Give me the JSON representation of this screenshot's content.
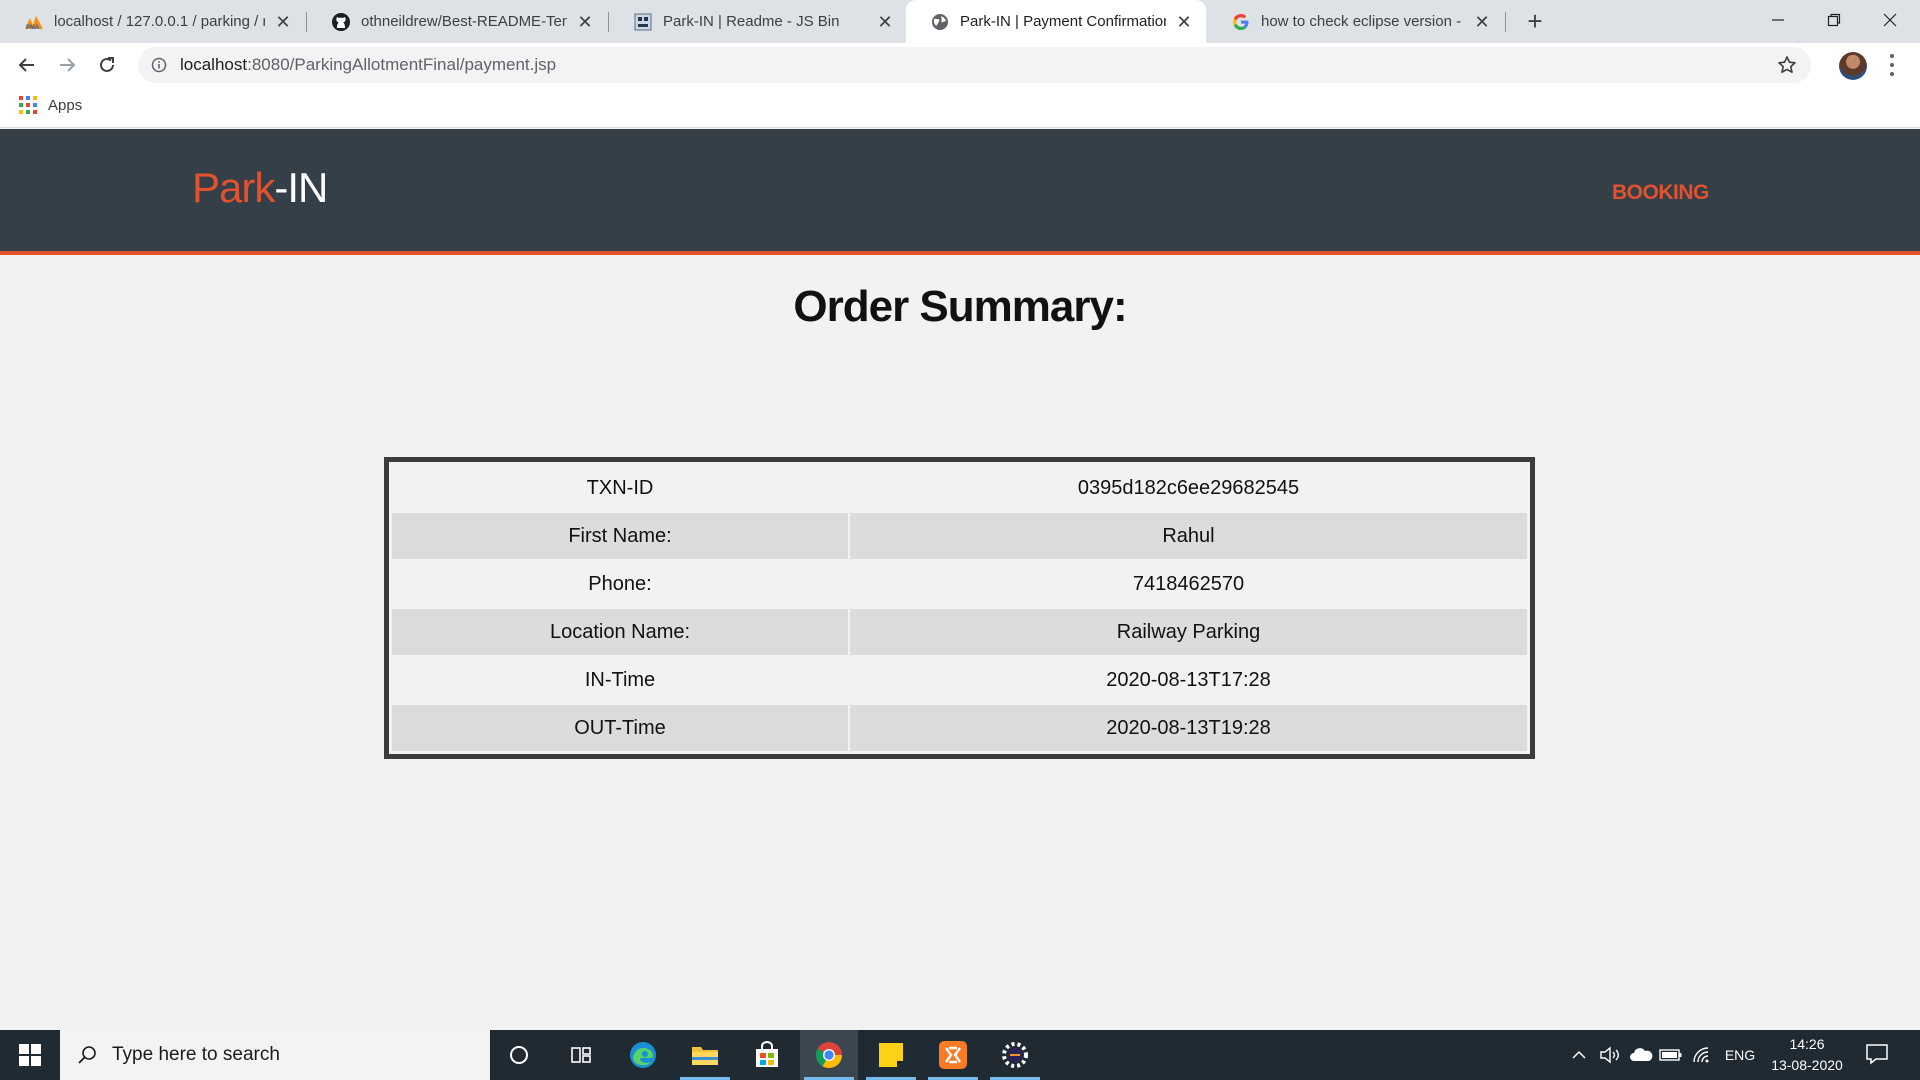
{
  "browser": {
    "tabs": [
      {
        "title": "localhost / 127.0.0.1 / parking / r",
        "favicon": "phpmyadmin-icon",
        "active": false
      },
      {
        "title": "othneildrew/Best-README-Temp",
        "favicon": "github-icon",
        "active": false
      },
      {
        "title": "Park-IN | Readme - JS Bin",
        "favicon": "jsbin-icon",
        "active": false
      },
      {
        "title": "Park-IN | Payment Confirmation",
        "favicon": "globe-icon",
        "active": true
      },
      {
        "title": "how to check eclipse version - Gc",
        "favicon": "google-icon",
        "active": false
      }
    ],
    "url_host": "localhost",
    "url_path": ":8080/ParkingAllotmentFinal/payment.jsp",
    "bookmarks": {
      "apps_label": "Apps"
    }
  },
  "site": {
    "brand_part1": "Park",
    "brand_part2": "-IN",
    "nav_booking": "BOOKING",
    "brand_color": "#e2522f",
    "header_color": "#343f48"
  },
  "order": {
    "title": "Order Summary:",
    "rows": [
      {
        "label": "TXN-ID",
        "value": "0395d182c6ee29682545"
      },
      {
        "label": "First Name:",
        "value": "Rahul"
      },
      {
        "label": "Phone:",
        "value": "7418462570"
      },
      {
        "label": "Location Name:",
        "value": "Railway Parking"
      },
      {
        "label": "IN-Time",
        "value": "2020-08-13T17:28"
      },
      {
        "label": "OUT-Time",
        "value": "2020-08-13T19:28"
      }
    ]
  },
  "taskbar": {
    "search_placeholder": "Type here to search",
    "language": "ENG",
    "time": "14:26",
    "date": "13-08-2020"
  }
}
